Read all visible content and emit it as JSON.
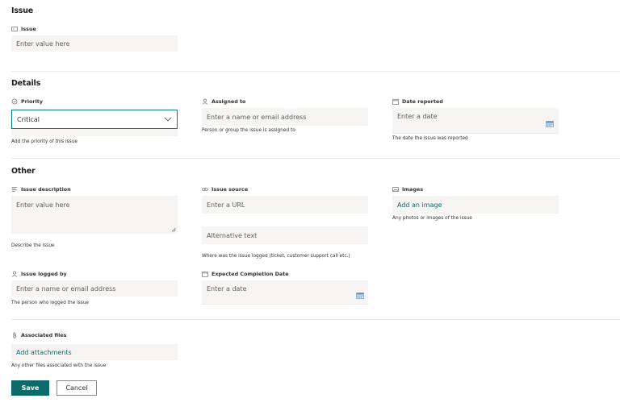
{
  "sections": {
    "issue": "Issue",
    "details": "Details",
    "other": "Other"
  },
  "issue_field": {
    "label": "Issue",
    "placeholder": "Enter value here",
    "icon": "textbox-icon"
  },
  "priority": {
    "label": "Priority",
    "value": "Critical",
    "help": "Add the priority of this issue",
    "icon": "status-circle-icon"
  },
  "assigned_to": {
    "label": "Assigned to",
    "placeholder": "Enter a name or email address",
    "help": "Person or group the issue is assigned to",
    "icon": "person-icon"
  },
  "date_reported": {
    "label": "Date reported",
    "placeholder": "Enter a date",
    "help": "The date the issue was reported",
    "icon": "calendar-icon"
  },
  "issue_description": {
    "label": "Issue description",
    "placeholder": "Enter value here",
    "help": "Describe the issue",
    "icon": "text-lines-icon"
  },
  "issue_source": {
    "label": "Issue source",
    "url_placeholder": "Enter a URL",
    "alt_placeholder": "Alternative text",
    "help": "Where was the issue logged (ticket, customer support call etc.)",
    "icon": "link-icon"
  },
  "images": {
    "label": "Images",
    "action": "Add an image",
    "help": "Any photos or images of the issue",
    "icon": "image-icon"
  },
  "issue_logged_by": {
    "label": "Issue logged by",
    "placeholder": "Enter a name or email address",
    "help": "The person who logged the issue",
    "icon": "person-icon"
  },
  "expected_completion": {
    "label": "Expected Completion Date",
    "placeholder": "Enter a date",
    "icon": "calendar-icon"
  },
  "associated_files": {
    "label": "Associated files",
    "action": "Add attachments",
    "help": "Any other files associated with the issue",
    "icon": "paperclip-icon"
  },
  "actions": {
    "save": "Save",
    "cancel": "Cancel"
  },
  "colors": {
    "accent": "#0b6a6a",
    "field_bg": "#f6f5f4",
    "divider": "#edebe9"
  }
}
